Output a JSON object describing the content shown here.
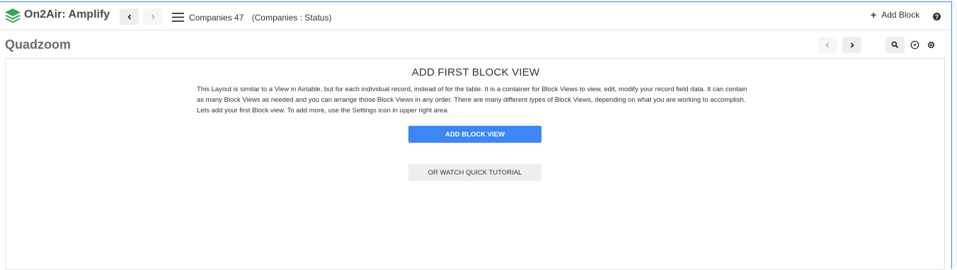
{
  "app": {
    "title": "On2Air: Amplify",
    "brand_color": "#3aa655"
  },
  "header": {
    "back_icon": "chevron-left",
    "forward_icon": "chevron-right",
    "menu_icon": "hamburger",
    "breadcrumb": {
      "table": "Companies 47",
      "view": "(Companies : Status)"
    },
    "add_block_label": "Add Block",
    "help_icon": "question-circle"
  },
  "subheader": {
    "page_title": "Quadzoom",
    "prev_icon": "chevron-left",
    "next_icon": "chevron-right",
    "tools": [
      "search",
      "compass",
      "gear"
    ]
  },
  "main": {
    "heading": "ADD FIRST BLOCK VIEW",
    "description": "This Layout is similar to a View in Airtable, but for each individual record, instead of for the table. It is a container for Block Views to view, edit, modify your record field data. It can contain as many Block Views as needed and you can arrange those Block Views in any order. There are many different types of Block Views, depending on what you are working to accomplish. Lets add your first Block view. To add more, use the Settings icon in upper right area.",
    "primary_button": "ADD BLOCK VIEW",
    "secondary_button": "OR WATCH QUICK TUTORIAL"
  },
  "colors": {
    "accent": "#3d87f5",
    "frame_border": "#3b86f0"
  }
}
